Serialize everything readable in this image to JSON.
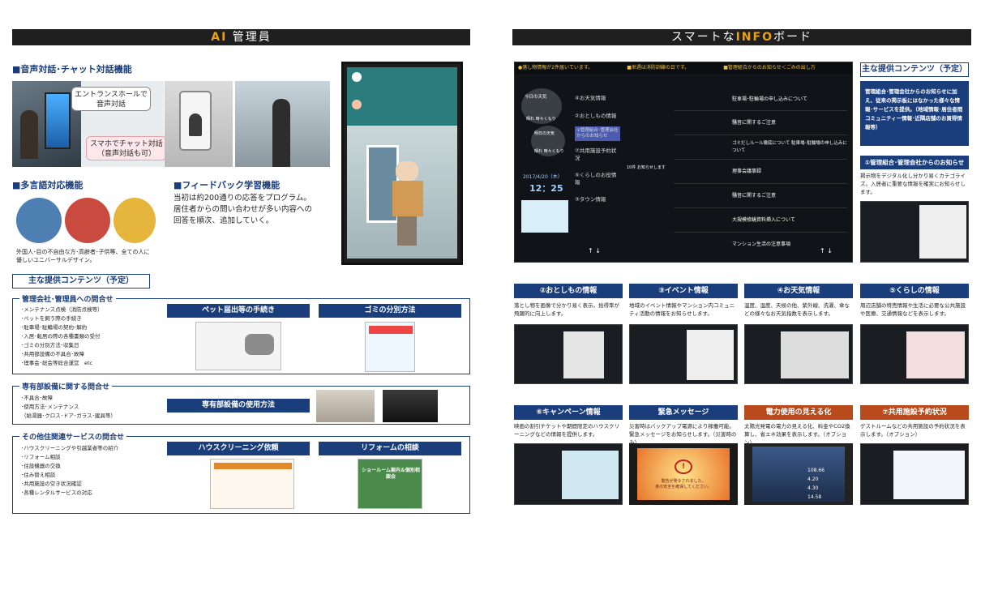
{
  "left": {
    "banner_ai": "AI",
    "banner_title": "管理員",
    "voice_head": "音声対話･チャット対話機能",
    "bubble_entrance": "エントランスホールで\n音声対話",
    "bubble_smartphone": "スマホでチャット対話\n（音声対話も可）",
    "multi_head": "多言語対応機能",
    "multi_desc": "外国人･目の不自由な方･高齢者･子供等、全ての人に\n優しいユニバーサルデザイン。",
    "feedback_head": "フィードバック学習機能",
    "feedback_desc": "当初は約200通りの応答をプログラム。\n居住者からの問い合わせが多い内容への\n回答を順次、追加していく。",
    "contents_head": "主な提供コンテンツ（予定）",
    "box1": {
      "head": "管理会社･管理員への問合せ",
      "items": [
        "･メンテナンス点検（消防点検等）",
        "･ペットを飼う際の手続き",
        "･駐車場･駐輪場の契約･解約",
        "･入居･転居の際の各種書類の受付",
        "･ゴミの分別方法･収集日",
        "･共用部設備の不具合･故障",
        "･理事会･総会等総合運営　etc"
      ],
      "btn1": "ペット届出等の手続き",
      "btn2": "ゴミの分別方法"
    },
    "box2": {
      "head": "専有部設備に関する問合せ",
      "items": [
        "･不具合･故障",
        "･使用方法･メンテナンス",
        "（給湯器･クロス･ドア･ガラス･建具等）"
      ],
      "btn": "専有部設備の使用方法"
    },
    "box3": {
      "head": "その他住関連サービスの問合せ",
      "items": [
        "･ハウスクリーニングや引越業者等の紹介",
        "･リフォーム相談",
        "･住設機器の交換",
        "･住み替え相談",
        "･共用施設の空き状況確認",
        "･各種レンタルサービスの対応"
      ],
      "btn1": "ハウスクリーニング依頼",
      "btn2": "リフォームの相談"
    },
    "reform_doc_title": "ショールーム案内＆個別相談会"
  },
  "right": {
    "banner_pre": "スマートな",
    "banner_accent": "INFO",
    "banner_post": "ボード",
    "screen": {
      "ticker1": "●落し物情報が2件届いています。",
      "ticker2": "■来週は消防訓練の日です。",
      "ticker3": "■管理組合からのお知らせ＜ごみの出し方",
      "weather_today": "今日の天気",
      "weather_tomorrow": "明日の天気",
      "weather_desc1": "晴れ 時々くもり",
      "weather_desc2": "晴れ 時々くもり",
      "date": "2017/4/20（木）",
      "time": "12：25",
      "menu": [
        "④お天気情報",
        "②おとしもの情報",
        "①管理組合･管理会社からのお知らせ",
        "⑦共用施設予約状況",
        "⑤くらしのお役情報",
        "③タウン情報"
      ],
      "notices": [
        "駐車場･駐輪場の申し込みについて",
        "騒音に関するご注意",
        "ゴミだしルール徹底について 駐車場･駐輪場の申し込みについて",
        "理事会議事録",
        "騒音に関するご注意",
        "大規模修繕資料挿入について",
        "マンション生活の注意事項"
      ],
      "count": "10件 お知らせします"
    },
    "contents_head": "主な提供コンテンツ（予定）",
    "contents_desc": "管理組合･管理会社からのお知らせに加え、従来の掲示板にはなかった様々な情報･サービスを提供。（地域情報･居住者間コミュニティー情報･近隣店舗のお買得情報等）",
    "item1_head": "①管理組合･管理会社からのお知らせ",
    "item1_desc": "掲示物をデジタル化し分かり易くカテゴライズ。入居者に重要な情報を確実にお知らせします。",
    "tiles": [
      {
        "head": "②おとしもの情報",
        "desc": "落とし物を画像で分かり易く表示。拾得率が飛躍的に向上します。"
      },
      {
        "head": "③イベント情報",
        "desc": "地域のイベント情報やマンション内コミュニティ活動の情報をお知らせします。"
      },
      {
        "head": "④お天気情報",
        "desc": "温度、湿度、天候の他、紫外線、洗濯、傘などの様々なお天気指数を表示します。"
      },
      {
        "head": "⑤くらしの情報",
        "desc": "周辺店舗の特売情報や生活に必要な公共施設や医療、交通情報などを表示します。"
      },
      {
        "head": "⑥キャンペーン情報",
        "desc": "映画の割引チケットや期間限定のハウスクリーニングなどの情報を提供します。"
      },
      {
        "head": "緊急メッセージ",
        "desc": "災害時はバックアップ電源により稼働可能。緊急メッセージをお知らせします。（災害時のみ）"
      },
      {
        "head": "電力使用の見える化",
        "desc": "太陽光発電の電力の見える化、料金やCO2換算し、省エネ効果を表示します。（オプション）"
      },
      {
        "head": "⑦共用施設予約状況",
        "desc": "ゲストルームなどの共用施設の予約状況を表示します。（オプション）"
      }
    ],
    "emergency_text": "警告が発令されました。\n身の安全を確保してください。",
    "power_vals": [
      "108.66",
      "4.20",
      "4.30",
      "14.58"
    ]
  },
  "colors": {
    "navy": "#1a3d7c",
    "orange": "#b84a1c",
    "accent": "#e8a117",
    "banner": "#1f1f1f"
  }
}
